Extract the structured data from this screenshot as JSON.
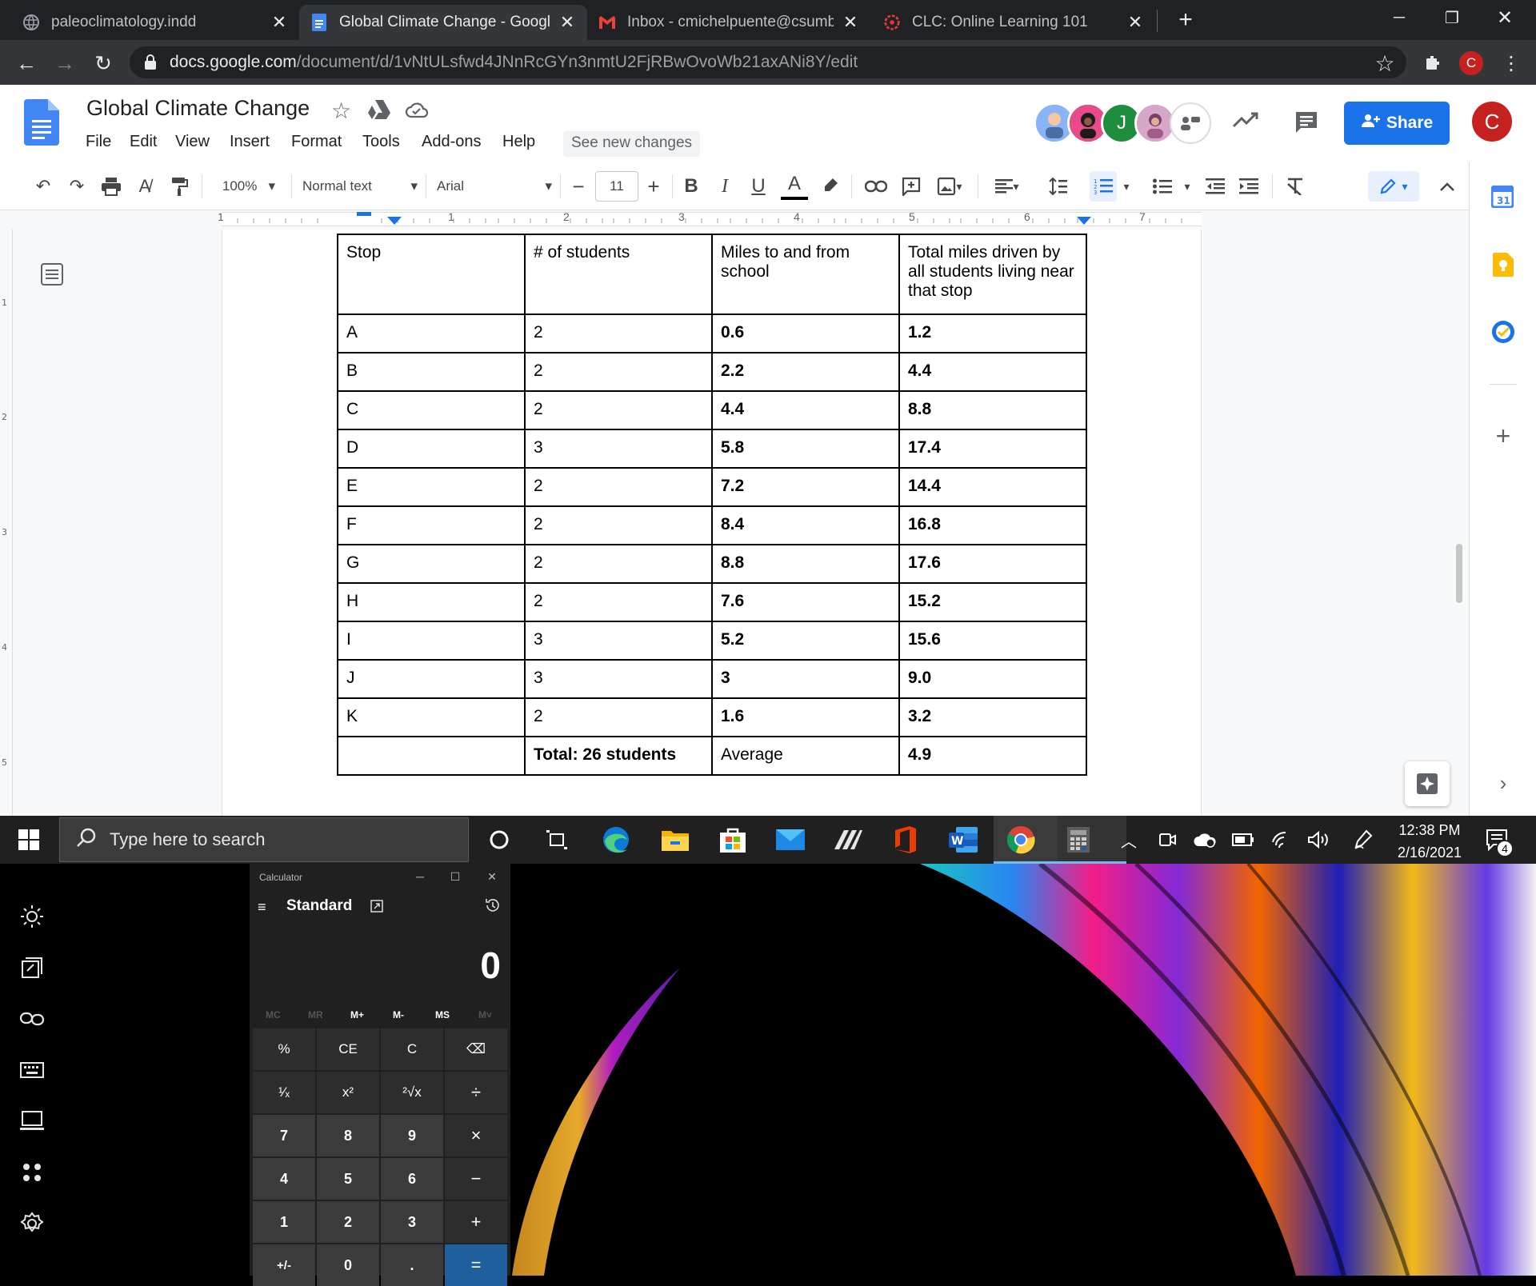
{
  "browser": {
    "tabs": [
      {
        "title": "paleoclimatology.indd",
        "icon": "globe-icon",
        "active": false
      },
      {
        "title": "Global Climate Change - Google",
        "icon": "docs-icon",
        "active": true
      },
      {
        "title": "Inbox - cmichelpuente@csumb.e",
        "icon": "gmail-icon",
        "active": false
      },
      {
        "title": "CLC: Online Learning 101",
        "icon": "clc-icon",
        "active": false
      }
    ],
    "url_host": "docs.google.com",
    "url_path": "/document/d/1vNtULsfwd4JNnRcGYn3nmtU2FjRBwOvoWb21axANi8Y/edit",
    "profile_initial": "C"
  },
  "docs": {
    "title": "Global Climate Change",
    "menu": [
      "File",
      "Edit",
      "View",
      "Insert",
      "Format",
      "Tools",
      "Add-ons",
      "Help"
    ],
    "see_new_changes": "See new changes",
    "share_label": "Share",
    "collaborator_initial": "J",
    "account_initial": "C",
    "toolbar": {
      "zoom": "100%",
      "style": "Normal text",
      "font": "Arial",
      "font_size": "11"
    },
    "ruler_numbers": [
      "1",
      "1",
      "2",
      "3",
      "4",
      "5",
      "6",
      "7"
    ],
    "table": {
      "headers": [
        "Stop",
        "# of students",
        "Miles to and from school",
        "Total miles driven by all students living near that stop"
      ],
      "rows": [
        [
          "A",
          "2",
          "0.6",
          "1.2"
        ],
        [
          "B",
          "2",
          "2.2",
          "4.4"
        ],
        [
          "C",
          "2",
          "4.4",
          "8.8"
        ],
        [
          "D",
          "3",
          "5.8",
          "17.4"
        ],
        [
          "E",
          "2",
          "7.2",
          "14.4"
        ],
        [
          "F",
          "2",
          "8.4",
          "16.8"
        ],
        [
          "G",
          "2",
          "8.8",
          "17.6"
        ],
        [
          "H",
          "2",
          "7.6",
          "15.2"
        ],
        [
          "I",
          "3",
          "5.2",
          "15.6"
        ],
        [
          "J",
          "3",
          "3",
          "9.0"
        ],
        [
          "K",
          "2",
          "1.6",
          "3.2"
        ]
      ],
      "footer": [
        "",
        "Total: 26 students",
        "Average",
        "4.9"
      ]
    }
  },
  "taskbar": {
    "search_placeholder": "Type here to search",
    "time": "12:38 PM",
    "date": "2/16/2021",
    "notification_count": "4"
  },
  "calculator": {
    "window_title": "Calculator",
    "mode": "Standard",
    "display": "0",
    "memory": [
      "MC",
      "MR",
      "M+",
      "M-",
      "MS",
      "M˅"
    ],
    "keys": [
      [
        "%",
        "CE",
        "C",
        "⌫"
      ],
      [
        "¹⁄ₓ",
        "x²",
        "²√x",
        "÷"
      ],
      [
        "7",
        "8",
        "9",
        "×"
      ],
      [
        "4",
        "5",
        "6",
        "−"
      ],
      [
        "1",
        "2",
        "3",
        "+"
      ],
      [
        "+/-",
        "0",
        ".",
        "="
      ]
    ]
  }
}
